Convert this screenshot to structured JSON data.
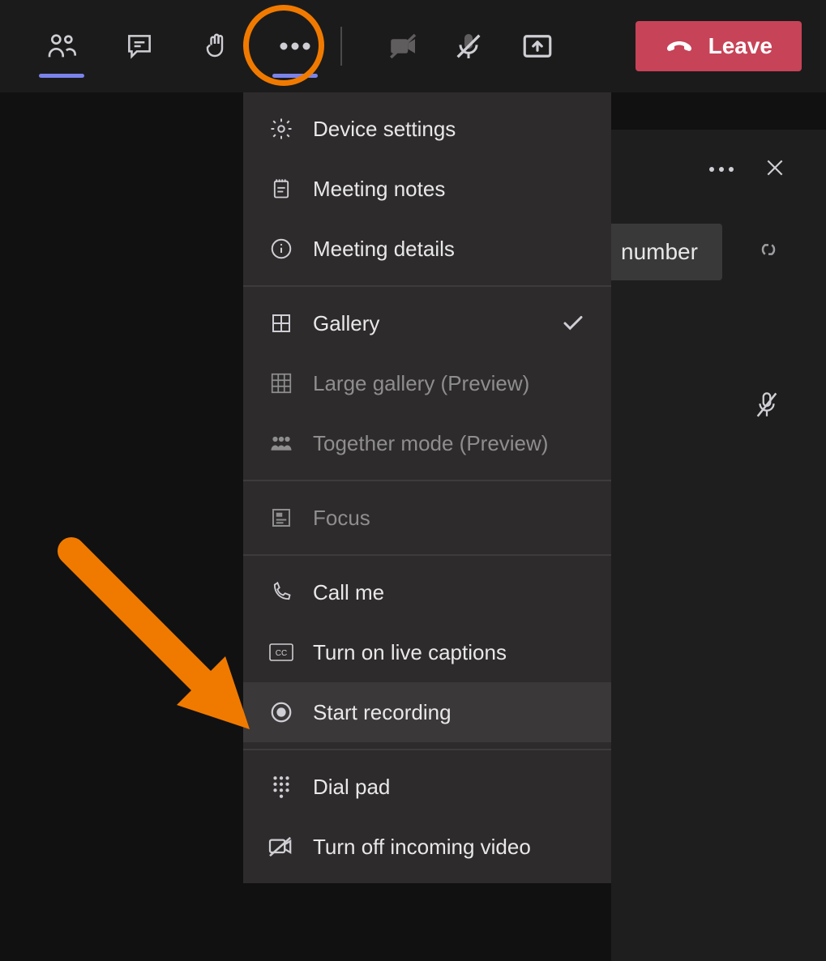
{
  "toolbar": {
    "leave_label": "Leave"
  },
  "menu": {
    "device_settings": "Device settings",
    "meeting_notes": "Meeting notes",
    "meeting_details": "Meeting details",
    "gallery": "Gallery",
    "large_gallery": "Large gallery (Preview)",
    "together_mode": "Together mode (Preview)",
    "focus": "Focus",
    "call_me": "Call me",
    "live_captions": "Turn on live captions",
    "start_recording": "Start recording",
    "dial_pad": "Dial pad",
    "turn_off_incoming": "Turn off incoming video"
  },
  "side": {
    "number_chip": "number"
  }
}
